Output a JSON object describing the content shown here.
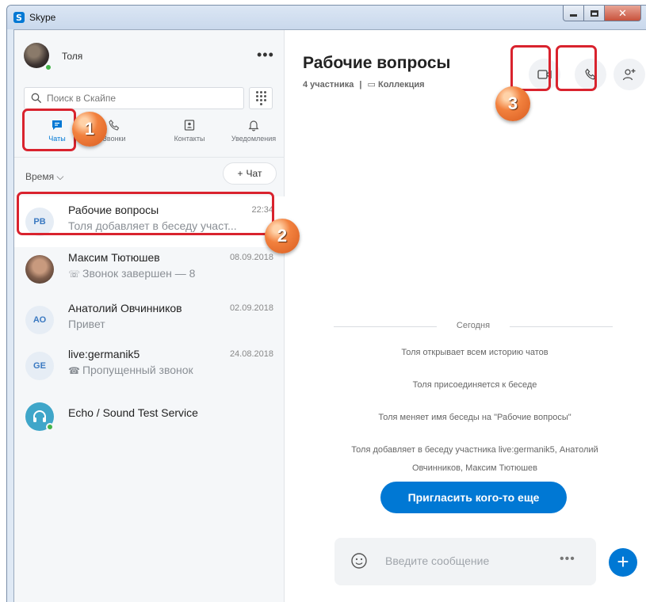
{
  "window": {
    "title": "Skype",
    "logo_letter": "S"
  },
  "profile": {
    "name": "Толя",
    "more": "•••"
  },
  "search": {
    "placeholder": "Поиск в Скайпе"
  },
  "nav": [
    {
      "label": "Чаты",
      "icon": "chat-icon"
    },
    {
      "label": "Звонки",
      "icon": "phone-icon"
    },
    {
      "label": "Контакты",
      "icon": "contacts-icon"
    },
    {
      "label": "Уведомления",
      "icon": "bell-icon"
    }
  ],
  "sort": {
    "label": "Время ⌵"
  },
  "new_chat": {
    "plus": "+",
    "label": "Чат"
  },
  "chats": [
    {
      "initials": "РВ",
      "name": "Рабочие вопросы",
      "time": "22:34",
      "preview": "Толя добавляет в беседу участ...",
      "glyph": ""
    },
    {
      "initials": "",
      "name": "Максим Тютюшев",
      "time": "08.09.2018",
      "preview": "Звонок завершен — 8",
      "glyph": "☏"
    },
    {
      "initials": "АО",
      "name": "Анатолий Овчинников",
      "time": "02.09.2018",
      "preview": "Привет",
      "glyph": ""
    },
    {
      "initials": "GE",
      "name": "live:germanik5",
      "time": "24.08.2018",
      "preview": "Пропущенный звонок",
      "glyph": "☎"
    },
    {
      "initials": "",
      "name": "Echo / Sound Test Service",
      "time": "",
      "preview": "",
      "glyph": ""
    }
  ],
  "conversation": {
    "title": "Рабочие вопросы",
    "participants": "4 участника",
    "separator": "|",
    "gallery": "Коллекция",
    "date_divider": "Сегодня",
    "system_messages": [
      "Толя открывает всем историю чатов",
      "Толя присоединяется к беседе",
      "Толя меняет имя беседы на \"Рабочие вопросы\"",
      "Толя добавляет в беседу участника live:germanik5, Анатолий Овчинников, Максим Тютюшев"
    ],
    "invite_button": "Пригласить кого-то еще"
  },
  "composer": {
    "placeholder": "Введите сообщение",
    "more": "•••",
    "plus": "+"
  },
  "annotations": {
    "step1": "1",
    "step2": "2",
    "step3": "3"
  },
  "colors": {
    "accent": "#0078d4",
    "highlight": "#d9232e",
    "badge": "#f2813e",
    "presence": "#43b449"
  }
}
